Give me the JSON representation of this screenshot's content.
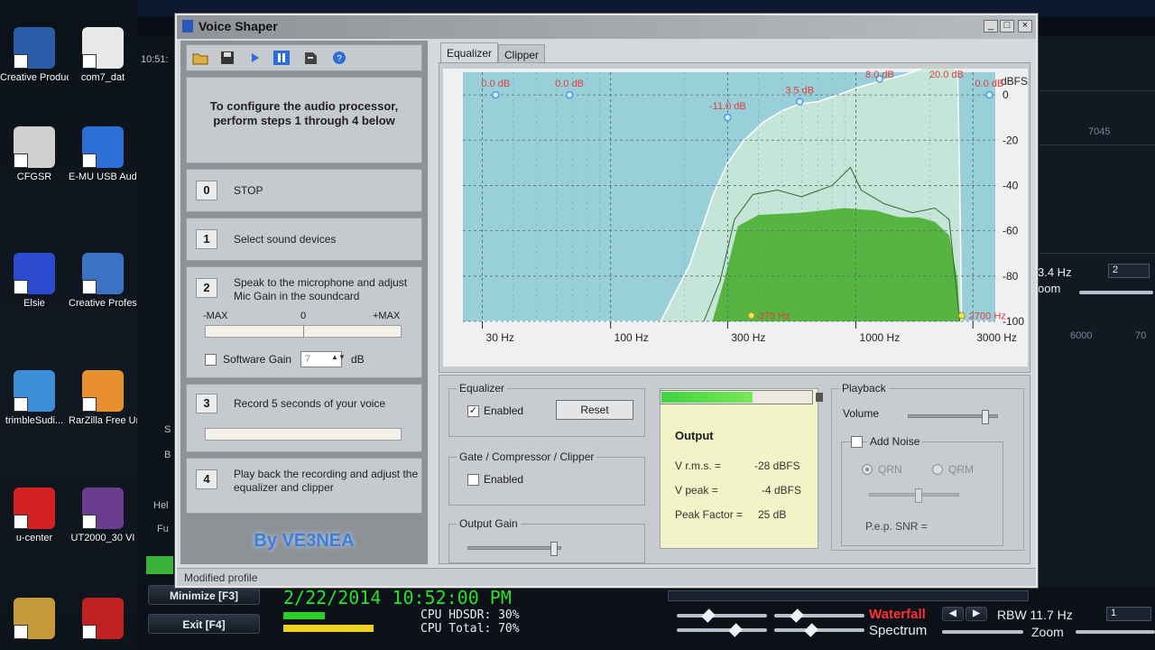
{
  "desktop": {
    "icons": [
      {
        "label": "Creative Product ...",
        "color": "#2a5da8"
      },
      {
        "label": "com7_dat",
        "color": "#e8e8e8"
      },
      {
        "label": "CFGSR",
        "color": "#d0d0d0"
      },
      {
        "label": "E-MU USB Audio A...",
        "color": "#2d6fd6"
      },
      {
        "label": "Elsie",
        "color": "#2b4bd1"
      },
      {
        "label": "Creative Professio...",
        "color": "#3a73c4"
      },
      {
        "label": "trimbleSudi...",
        "color": "#3c8ed8"
      },
      {
        "label": "RarZilla Free Unrar",
        "color": "#e89030"
      },
      {
        "label": "u-center",
        "color": "#d42020"
      },
      {
        "label": "UT2000_30 VI",
        "color": "#6a3c8e"
      },
      {
        "label": "",
        "color": "#c49a3a"
      },
      {
        "label": "",
        "color": "#c02020"
      }
    ]
  },
  "hdsdr": {
    "clock_small": "10:51:",
    "datetime": "2/22/2014 10:52:00 PM",
    "cpu_hdsdr": "CPU HDSDR: 30%",
    "cpu_total": "CPU Total: 70%",
    "minimize": "Minimize  [F3]",
    "exit": "Exit      [F4]",
    "waterfall": "Waterfall",
    "spectrum": "Spectrum",
    "rbw": "RBW 11.7 Hz",
    "zoom": "Zoom",
    "zoom_top": "oom",
    "freq_readout": "3.4 Hz",
    "freq_7045": "7045",
    "freq_6000": "6000",
    "freq_70": "70",
    "combo_val": "2",
    "combo_val2": "1",
    "left_labels": [
      "S",
      "B",
      "Hel",
      "Fu"
    ]
  },
  "window": {
    "title": "Voice Shaper",
    "minimize_glyph": "_",
    "maximize_glyph": "□",
    "close_glyph": "×",
    "toolbar_icons": [
      "open-folder-icon",
      "save-icon",
      "play-icon",
      "pause-icon",
      "export-icon",
      "help-icon"
    ],
    "intro": "To configure the audio processor, perform steps 1 through 4 below",
    "steps": [
      {
        "num": "0",
        "text": "STOP"
      },
      {
        "num": "1",
        "text": "Select sound devices"
      },
      {
        "num": "2",
        "text": "Speak to the microphone and adjust Mic Gain in the soundcard"
      },
      {
        "num": "3",
        "text": "Record 5 seconds of your voice"
      },
      {
        "num": "4",
        "text": "Play back the recording and adjust the equalizer and clipper"
      }
    ],
    "meter_labels": {
      "left": "-MAX",
      "center": "0",
      "right": "+MAX"
    },
    "software_gain": {
      "label": "Software Gain",
      "value": "7",
      "unit": "dB"
    },
    "byline": "By VE3NEA",
    "tabs": [
      "Equalizer",
      "Clipper"
    ],
    "status": "Modified profile"
  },
  "chart_data": {
    "type": "line",
    "title": "",
    "xlabel": "",
    "ylabel": "dBFS",
    "x_scale": "log",
    "xlim": [
      25,
      3700
    ],
    "ylim": [
      -100,
      10
    ],
    "x_ticks": [
      {
        "v": 30,
        "label": "30 Hz"
      },
      {
        "v": 100,
        "label": "100 Hz"
      },
      {
        "v": 300,
        "label": "300 Hz"
      },
      {
        "v": 1000,
        "label": "1000 Hz"
      },
      {
        "v": 3000,
        "label": "3000 Hz"
      }
    ],
    "y_ticks": [
      0,
      -20,
      -40,
      -60,
      -80,
      -100
    ],
    "equalizer_points": [
      {
        "x": 34,
        "y": 0,
        "label": "0.0 dB"
      },
      {
        "x": 68,
        "y": 0,
        "label": "0.0 dB"
      },
      {
        "x": 300,
        "y": -10,
        "label": "-11.0 dB"
      },
      {
        "x": 590,
        "y": -3,
        "label": "3.5 dB"
      },
      {
        "x": 1250,
        "y": 7,
        "label": "8.0 dB"
      },
      {
        "x": 2340,
        "y": 19,
        "label": "20.0 dB"
      },
      {
        "x": 3500,
        "y": 0,
        "label": "0.0 dB"
      }
    ],
    "filter_markers": [
      {
        "x": 375,
        "y": -95,
        "label": "375 Hz"
      },
      {
        "x": 2700,
        "y": -95,
        "label": "2700 Hz"
      }
    ],
    "response_curve": [
      [
        30,
        -100
      ],
      [
        160,
        -100
      ],
      [
        210,
        -75
      ],
      [
        260,
        -45
      ],
      [
        300,
        -30
      ],
      [
        350,
        -20
      ],
      [
        420,
        -12
      ],
      [
        500,
        -7
      ],
      [
        590,
        -4
      ],
      [
        700,
        -3
      ],
      [
        850,
        0
      ],
      [
        1000,
        3
      ],
      [
        1250,
        6
      ],
      [
        1600,
        9
      ],
      [
        2000,
        13
      ],
      [
        2340,
        16
      ],
      [
        2600,
        10
      ],
      [
        2650,
        -40
      ],
      [
        2700,
        -100
      ],
      [
        3500,
        -100
      ]
    ],
    "avg_spectrum": [
      [
        260,
        -100
      ],
      [
        290,
        -82
      ],
      [
        330,
        -58
      ],
      [
        400,
        -53
      ],
      [
        600,
        -52
      ],
      [
        900,
        -50
      ],
      [
        1200,
        -51
      ],
      [
        1500,
        -54
      ],
      [
        1800,
        -54
      ],
      [
        2100,
        -56
      ],
      [
        2400,
        -62
      ],
      [
        2600,
        -82
      ],
      [
        2650,
        -100
      ]
    ],
    "peak_spectrum": [
      [
        240,
        -100
      ],
      [
        280,
        -82
      ],
      [
        320,
        -55
      ],
      [
        380,
        -44
      ],
      [
        480,
        -42
      ],
      [
        600,
        -45
      ],
      [
        800,
        -40
      ],
      [
        950,
        -32
      ],
      [
        1050,
        -42
      ],
      [
        1300,
        -48
      ],
      [
        1700,
        -52
      ],
      [
        2100,
        -50
      ],
      [
        2400,
        -55
      ],
      [
        2650,
        -100
      ]
    ],
    "colors": {
      "plot_bg": "#98cfd9",
      "curve_fill": "#cbe9d7",
      "curve_line": "#ffffff",
      "spectrum": "#56b541",
      "grid": "#5a6e78",
      "label": "#e04040",
      "marker": "#4aa0e0"
    }
  },
  "equalizer": {
    "label": "Equalizer",
    "enabled_label": "Enabled",
    "enabled": true,
    "reset_label": "Reset"
  },
  "gate": {
    "label": "Gate / Compressor / Clipper",
    "enabled_label": "Enabled",
    "enabled": false
  },
  "output_gain": {
    "label": "Output Gain",
    "level": 0.95
  },
  "output": {
    "title": "Output",
    "level_fill": 0.6,
    "vrms_label": "V r.m.s. =",
    "vrms_value": "-28 dBFS",
    "vpeak_label": "V peak =",
    "vpeak_value": "-4 dBFS",
    "peak_factor_label": "Peak Factor =",
    "peak_factor_value": "25 dB"
  },
  "playback": {
    "label": "Playback",
    "volume_label": "Volume",
    "volume_level": 0.88,
    "add_noise_label": "Add Noise",
    "qrn_label": "QRN",
    "qrm_label": "QRM",
    "pep_label": "P.e.p. SNR ="
  }
}
